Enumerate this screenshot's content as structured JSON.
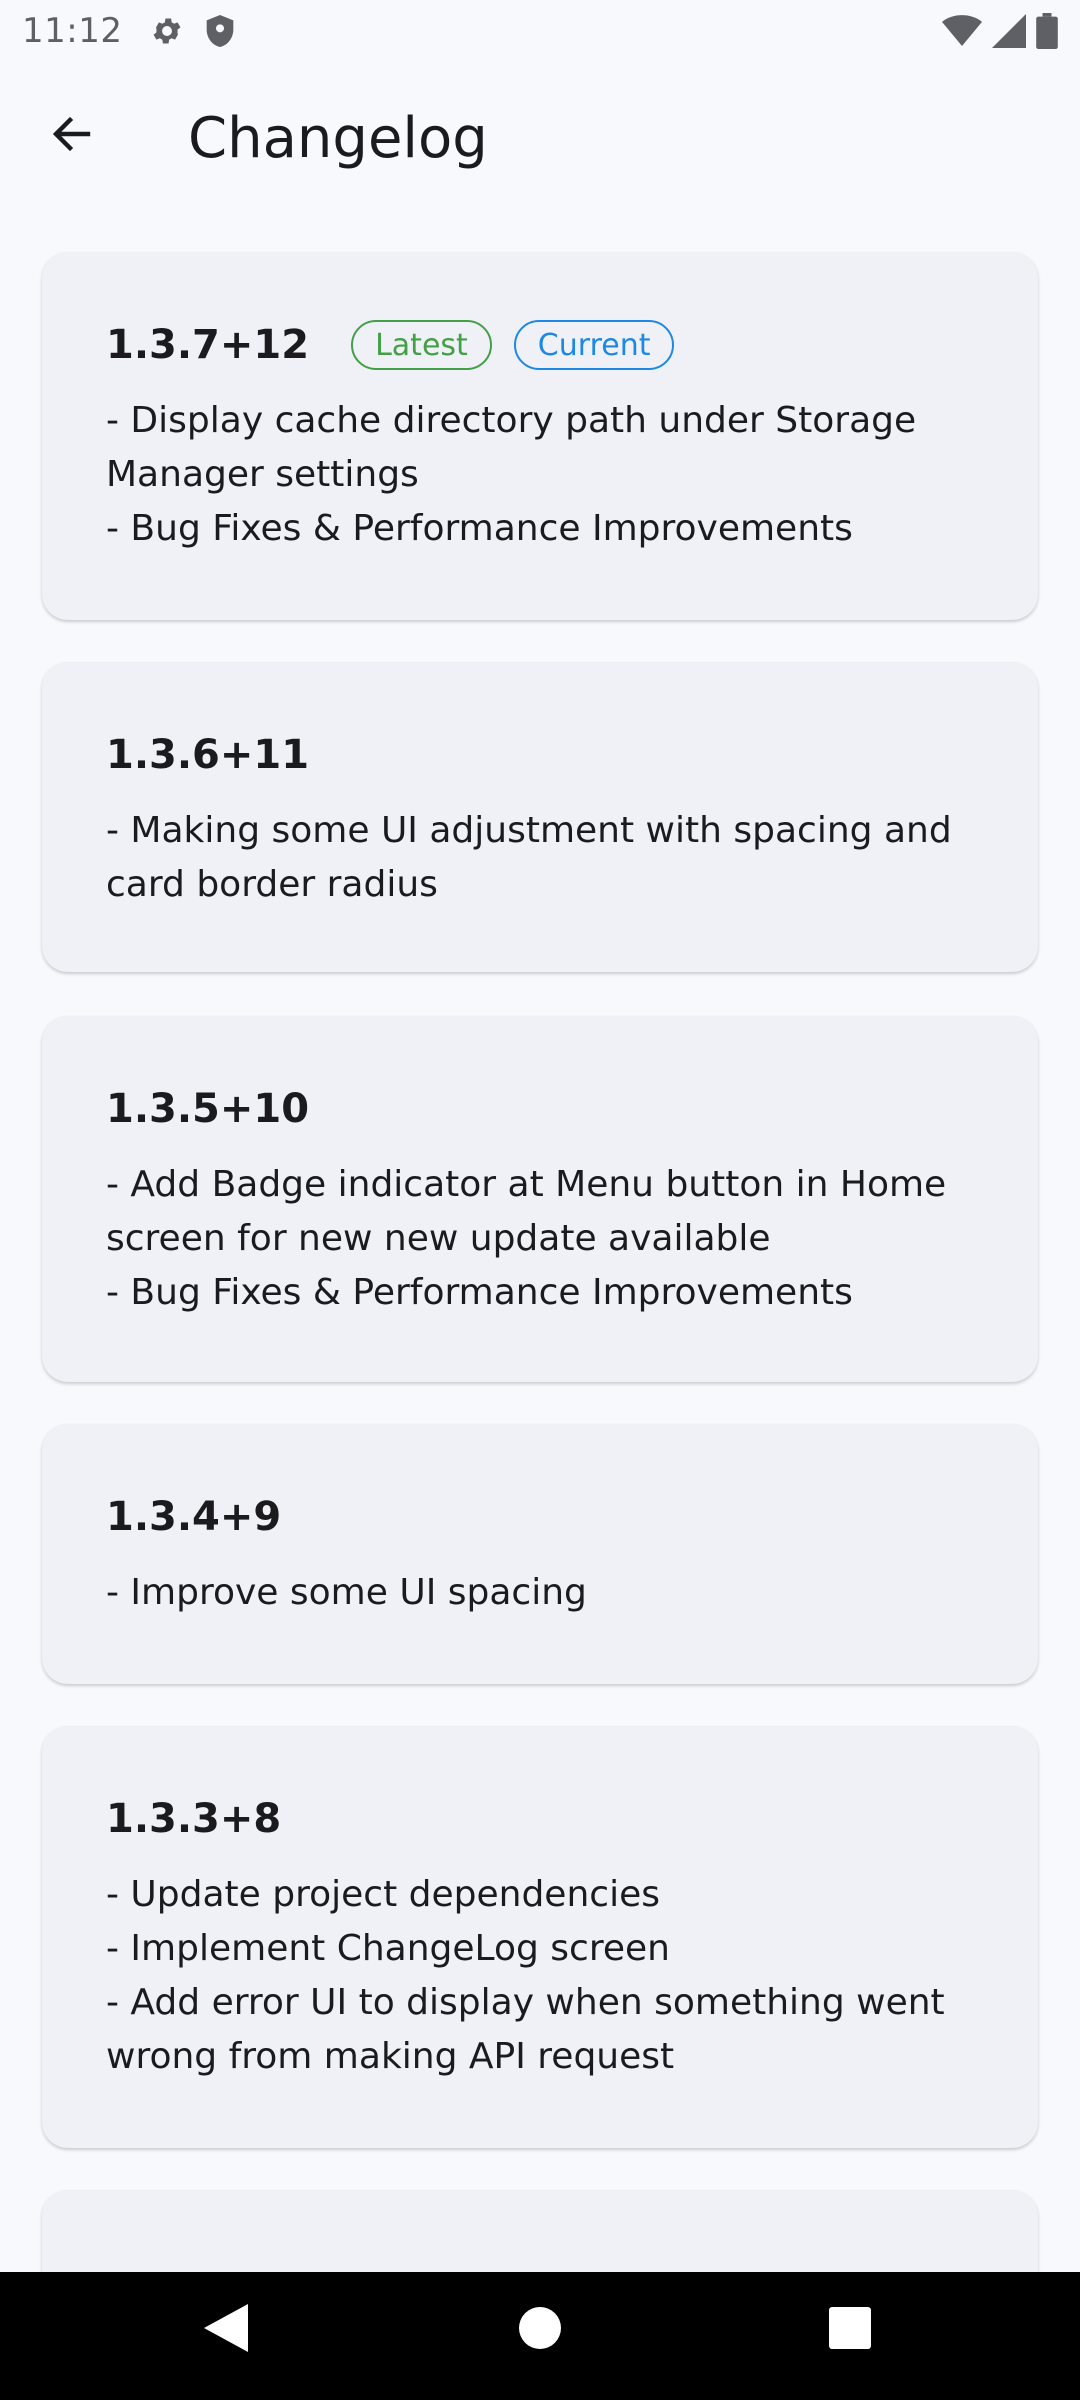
{
  "status_bar": {
    "time": "11:12",
    "left_icons": [
      "gear-icon",
      "shield-icon"
    ],
    "right_icons": [
      "wifi-icon",
      "signal-icon",
      "battery-icon"
    ]
  },
  "app_bar": {
    "title": "Changelog",
    "back_icon": "arrow-left-icon"
  },
  "colors": {
    "background": "#f8f9fd",
    "card": "#f0f1f7",
    "latest_badge": "#43a047",
    "current_badge": "#1e88e5"
  },
  "changelog": [
    {
      "version": "1.3.7+12",
      "badges": {
        "latest": "Latest",
        "current": "Current"
      },
      "notes": [
        "- Display cache directory path under Storage Manager settings",
        "- Bug Fixes & Performance Improvements"
      ]
    },
    {
      "version": "1.3.6+11",
      "notes": [
        "- Making some UI adjustment with spacing and card border radius"
      ]
    },
    {
      "version": "1.3.5+10",
      "notes": [
        "- Add Badge indicator at Menu button in Home screen for new new update available",
        "- Bug Fixes & Performance Improvements"
      ]
    },
    {
      "version": "1.3.4+9",
      "notes": [
        "- Improve some UI spacing"
      ]
    },
    {
      "version": "1.3.3+8",
      "notes": [
        "- Update project dependencies",
        "- Implement ChangeLog screen",
        "- Add error UI to display when something went wrong from making API request"
      ]
    }
  ],
  "nav_bar": {
    "buttons": [
      "back-triangle-icon",
      "home-circle-icon",
      "recents-square-icon"
    ]
  }
}
